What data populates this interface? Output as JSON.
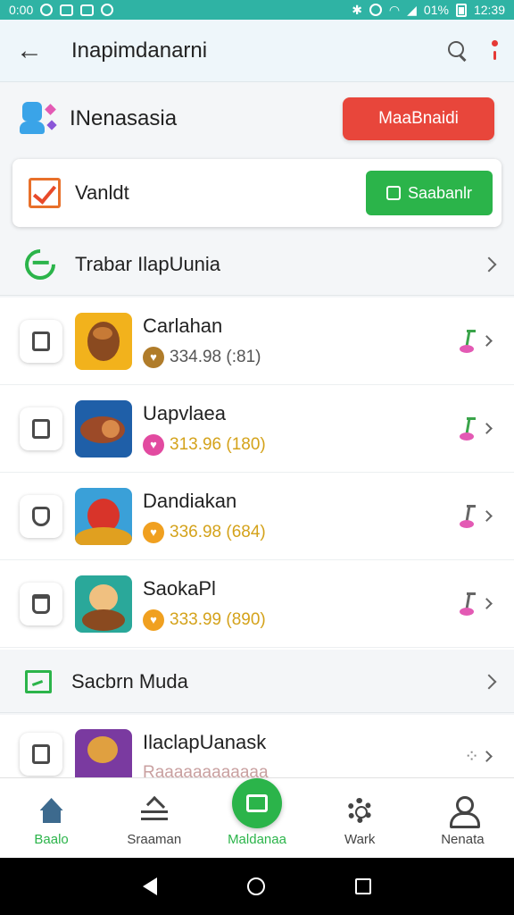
{
  "status_bar": {
    "time_left": "0:00",
    "battery_pct": "01%",
    "time_right": "12:39"
  },
  "app_bar": {
    "title": "Inapimdanarni",
    "back_icon": "arrow-left-icon",
    "search_icon": "search-icon",
    "more_icon": "more-icon"
  },
  "account": {
    "name": "INenasasia",
    "button_label": "MaaBnaidi"
  },
  "card": {
    "label": "Vanldt",
    "button_label": "Saabanlr"
  },
  "section1": {
    "label": "Trabar IlapUunia"
  },
  "list": [
    {
      "title": "Carlahan",
      "price": "334.98 (:81)",
      "badge_color": "#b07c2a",
      "price_color": "#555555",
      "note_color": "green",
      "lead_icon": "bag-icon"
    },
    {
      "title": "Uapvlaea",
      "price": "313.96 (180)",
      "badge_color": "#e24aa0",
      "price_color": "#d4a21a",
      "note_color": "green",
      "lead_icon": "calendar-icon"
    },
    {
      "title": "Dandiakan",
      "price": "336.98 (684)",
      "badge_color": "#f0a020",
      "price_color": "#d4a21a",
      "note_color": "gray",
      "lead_icon": "shield-icon"
    },
    {
      "title": "SaokaPl",
      "price": "333.99 (890)",
      "badge_color": "#f0a020",
      "price_color": "#d4a21a",
      "note_color": "gray",
      "lead_icon": "flask-icon"
    }
  ],
  "section2": {
    "label": "Sacbrn Muda"
  },
  "partial": {
    "title": "IlaclapUanask",
    "sub": "Raaaaaaaaaaaa"
  },
  "bottom_nav": [
    {
      "label": "Baalo",
      "icon": "home-icon"
    },
    {
      "label": "Sraaman",
      "icon": "sliders-icon"
    },
    {
      "label": "Maldanaa",
      "icon": "fab-icon"
    },
    {
      "label": "Wark",
      "icon": "gear-icon"
    },
    {
      "label": "Nenata",
      "icon": "person-icon"
    }
  ],
  "colors": {
    "accent_green": "#2bb44a",
    "accent_red": "#e8463b",
    "status_teal": "#2fb3a4"
  }
}
